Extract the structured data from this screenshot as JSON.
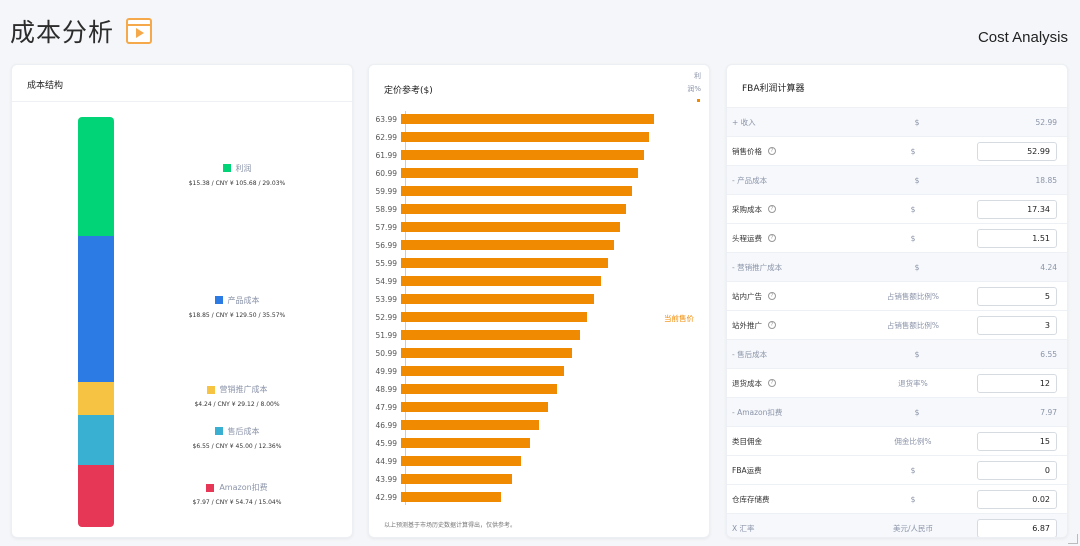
{
  "header": {
    "title": "成本分析",
    "subtitle": "Cost Analysis",
    "icon": "video-play-icon"
  },
  "structure": {
    "title": "成本结构",
    "segments": [
      {
        "label": "利润",
        "color": "#00d477",
        "fraction": 0.2903,
        "detail": "$15.38 / CNY ¥ 105.68 / 29.03%"
      },
      {
        "label": "产品成本",
        "color": "#2c7be5",
        "fraction": 0.3557,
        "detail": "$18.85 / CNY ¥ 129.50 / 35.57%"
      },
      {
        "label": "营销推广成本",
        "color": "#f6c343",
        "fraction": 0.08,
        "detail": "$4.24 / CNY ¥ 29.12 / 8.00%"
      },
      {
        "label": "售后成本",
        "color": "#39afd1",
        "fraction": 0.1236,
        "detail": "$6.55 / CNY ¥ 45.00 / 12.36%"
      },
      {
        "label": "Amazon扣费",
        "color": "#e63757",
        "fraction": 0.1504,
        "detail": "$7.97 / CNY ¥ 54.74 / 15.04%"
      }
    ]
  },
  "pricing": {
    "title": "定价参考($)",
    "legend": "利润%",
    "current_price_label": "当前售价",
    "note": "以上预测基于市场历史数据计算得出，仅供参考。",
    "color": "#f08a00"
  },
  "chart_data": {
    "type": "bar",
    "orientation": "horizontal",
    "title": "定价参考($)",
    "categories": [
      "63.99",
      "62.99",
      "61.99",
      "60.99",
      "59.99",
      "58.99",
      "57.99",
      "56.99",
      "55.99",
      "54.99",
      "53.99",
      "52.99",
      "51.99",
      "50.99",
      "49.99",
      "48.99",
      "47.99",
      "46.99",
      "45.99",
      "44.99",
      "43.99",
      "42.99"
    ],
    "values": [
      39.5,
      38.7,
      37.9,
      37.0,
      36.1,
      35.2,
      34.2,
      33.3,
      32.3,
      31.2,
      30.2,
      29.0,
      27.9,
      26.7,
      25.5,
      24.3,
      23.0,
      21.6,
      20.2,
      18.8,
      17.3,
      15.7
    ],
    "series": [
      {
        "name": "利润%"
      }
    ],
    "current_price": "52.99"
  },
  "fba": {
    "title": "FBA利润计算器",
    "rows": [
      {
        "type": "section",
        "name": "+ 收入",
        "unit": "$",
        "value": "52.99"
      },
      {
        "type": "input",
        "name": "销售价格",
        "help": true,
        "unit": "$",
        "value": "52.99"
      },
      {
        "type": "section",
        "name": "- 产品成本",
        "unit": "$",
        "value": "18.85"
      },
      {
        "type": "input",
        "name": "采购成本",
        "help": true,
        "unit": "$",
        "value": "17.34"
      },
      {
        "type": "input",
        "name": "头程运费",
        "help": true,
        "unit": "$",
        "value": "1.51"
      },
      {
        "type": "section",
        "name": "- 营销推广成本",
        "unit": "$",
        "value": "4.24"
      },
      {
        "type": "input",
        "name": "站内广告",
        "help": true,
        "unit": "占销售额比例%",
        "value": "5"
      },
      {
        "type": "input",
        "name": "站外推广",
        "help": true,
        "unit": "占销售额比例%",
        "value": "3"
      },
      {
        "type": "section",
        "name": "- 售后成本",
        "unit": "$",
        "value": "6.55"
      },
      {
        "type": "input",
        "name": "退货成本",
        "help": true,
        "unit": "退货率%",
        "value": "12"
      },
      {
        "type": "section",
        "name": "- Amazon扣费",
        "unit": "$",
        "value": "7.97"
      },
      {
        "type": "input",
        "name": "类目佣金",
        "help": false,
        "unit": "佣金比例%",
        "value": "15"
      },
      {
        "type": "input",
        "name": "FBA运费",
        "help": false,
        "unit": "$",
        "value": "0"
      },
      {
        "type": "input",
        "name": "仓库存储费",
        "help": false,
        "unit": "$",
        "value": "0.02"
      },
      {
        "type": "section-input",
        "name": "X 汇率",
        "unit": "美元/人民币",
        "value": "6.87"
      }
    ]
  }
}
